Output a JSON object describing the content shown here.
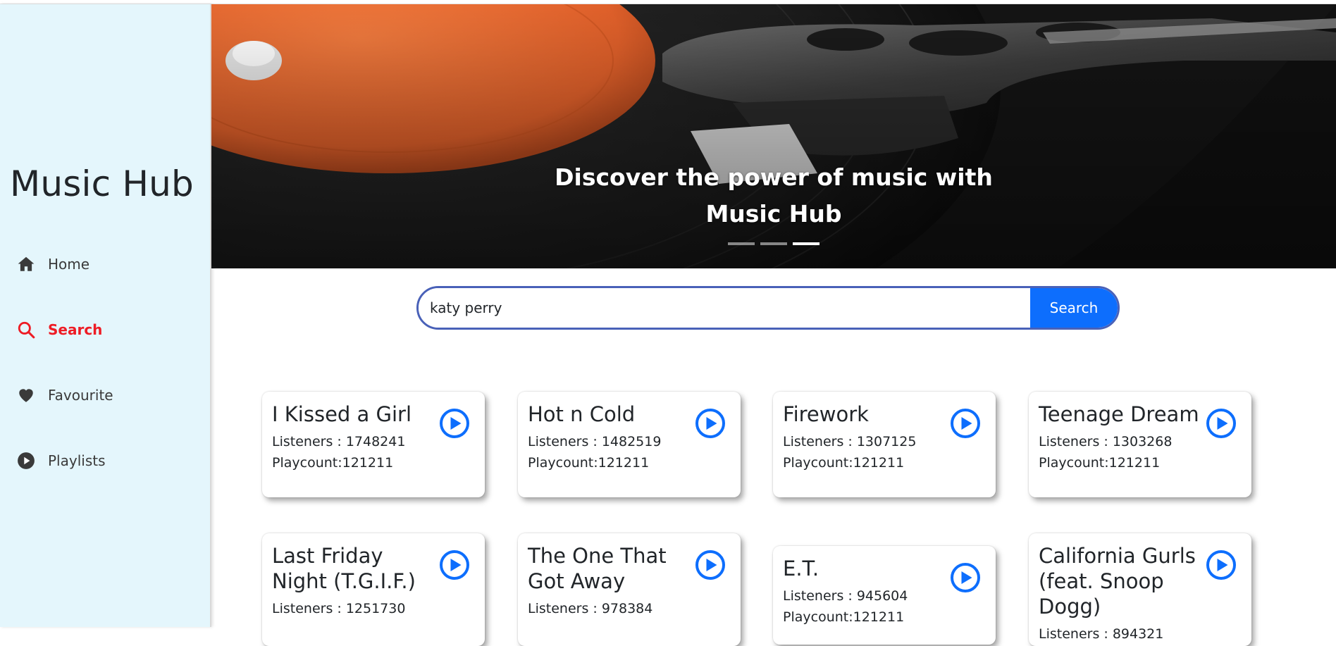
{
  "app": {
    "brand": "Music Hub"
  },
  "nav": [
    {
      "label": "Home",
      "icon": "home-icon",
      "active": false
    },
    {
      "label": "Search",
      "icon": "search-icon",
      "active": true
    },
    {
      "label": "Favourite",
      "icon": "heart-icon",
      "active": false
    },
    {
      "label": "Playlists",
      "icon": "play-circle-icon",
      "active": false
    }
  ],
  "hero": {
    "line1": "Discover the power of music with",
    "line2": "Music Hub",
    "slides": 3,
    "active_slide": 3
  },
  "search": {
    "value": "katy perry",
    "button": "Search"
  },
  "results": [
    {
      "title": "I Kissed a Girl",
      "listeners": "Listeners : 1748241",
      "playcount": "Playcount:121211"
    },
    {
      "title": "Hot n Cold",
      "listeners": "Listeners : 1482519",
      "playcount": "Playcount:121211"
    },
    {
      "title": "Firework",
      "listeners": "Listeners : 1307125",
      "playcount": "Playcount:121211"
    },
    {
      "title": "Teenage Dream",
      "listeners": "Listeners : 1303268",
      "playcount": "Playcount:121211"
    },
    {
      "title": "Last Friday Night (T.G.I.F.)",
      "listeners": "Listeners : 1251730",
      "playcount": ""
    },
    {
      "title": "The One That Got Away",
      "listeners": "Listeners : 978384",
      "playcount": ""
    },
    {
      "title": "E.T.",
      "listeners": "Listeners : 945604",
      "playcount": "Playcount:121211"
    },
    {
      "title": "California Gurls (feat. Snoop Dogg)",
      "listeners": "Listeners : 894321",
      "playcount": ""
    }
  ],
  "colors": {
    "sidebar_bg": "#e4f6fc",
    "active_nav": "#ee1c25",
    "accent": "#0d6efd",
    "search_border": "#4961b8",
    "vinyl_label": "#e8652f"
  }
}
